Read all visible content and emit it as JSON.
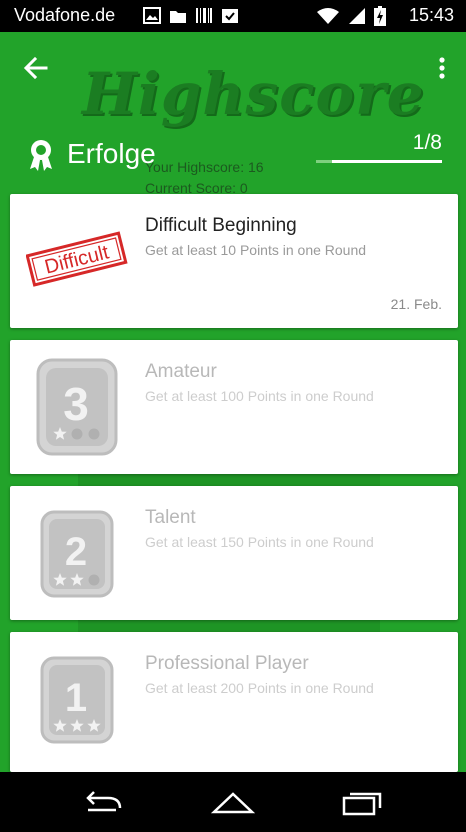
{
  "status_bar": {
    "carrier": "Vodafone.de",
    "time": "15:43",
    "left_icons": [
      "image-icon",
      "folder-icon",
      "barcode-icon",
      "clipboard-check-icon"
    ],
    "right_icons": [
      "wifi-icon",
      "signal-icon",
      "battery-charging-icon"
    ]
  },
  "background": {
    "title": "Highscore",
    "stats": [
      "Your Highscore: 16",
      "Current Score: 0"
    ]
  },
  "toolbar": {
    "back_icon": "arrow-back-icon",
    "menu_icon": "more-vert-icon",
    "section_icon": "award-icon",
    "title": "Erfolge",
    "counter": "1/8",
    "progress": 0.125
  },
  "achievements": [
    {
      "title": "Difficult Beginning",
      "description": "Get at least 10 Points in one Round",
      "date": "21. Feb.",
      "unlocked": true,
      "badge_text": "Difficult",
      "badge_color": "#d62828"
    },
    {
      "title": "Amateur",
      "description": "Get at least 100 Points in one Round",
      "date": "",
      "unlocked": false,
      "badge_number": "3",
      "stars": 1
    },
    {
      "title": "Talent",
      "description": "Get at least 150 Points in one Round",
      "date": "",
      "unlocked": false,
      "badge_number": "2",
      "stars": 2
    },
    {
      "title": "Professional Player",
      "description": "Get at least 200 Points in one Round",
      "date": "",
      "unlocked": false,
      "badge_number": "1",
      "stars": 3
    }
  ],
  "navbar": {
    "buttons": [
      "nav-back-icon",
      "nav-home-icon",
      "nav-recents-icon"
    ]
  },
  "colors": {
    "primary": "#22a32a",
    "status_bar": "#000000",
    "card": "#ffffff",
    "locked_text": "#b8b8b8"
  }
}
